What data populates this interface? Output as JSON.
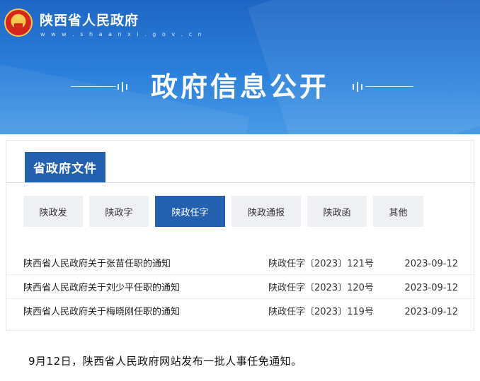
{
  "header": {
    "site_name": "陕西省人民政府",
    "site_url": "w w w . s h a a n x i . g o v . c n",
    "banner_title": "政府信息公开"
  },
  "section": {
    "title": "省政府文件"
  },
  "categories": [
    {
      "label": "陕政发"
    },
    {
      "label": "陕政字"
    },
    {
      "label": "陕政任字",
      "active": true
    },
    {
      "label": "陕政通报"
    },
    {
      "label": "陕政函"
    },
    {
      "label": "其他"
    }
  ],
  "documents": [
    {
      "title": "陕西省人民政府关于张苗任职的通知",
      "number": "陕政任字〔2023〕121号",
      "date": "2023-09-12"
    },
    {
      "title": "陕西省人民政府关于刘少平任职的通知",
      "number": "陕政任字〔2023〕120号",
      "date": "2023-09-12"
    },
    {
      "title": "陕西省人民政府关于梅晓刚任职的通知",
      "number": "陕政任字〔2023〕119号",
      "date": "2023-09-12"
    }
  ],
  "caption": "9月12日，陕西省人民政府网站发布一批人事任免通知。",
  "colors": {
    "banner_blue": "#2b80db",
    "accent_blue": "#2361b0",
    "tab_gray": "#eef0f3"
  }
}
